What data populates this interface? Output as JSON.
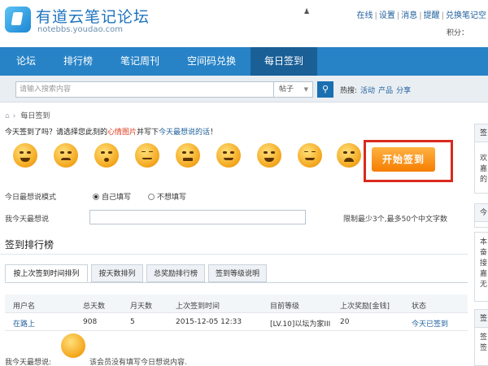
{
  "header": {
    "site_title": "有道云笔记论坛",
    "site_subtitle": "notebbs.youdao.com",
    "top_links": [
      "在线",
      "设置",
      "消息",
      "提醒",
      "兑换笔记空"
    ],
    "points_label": "积分：",
    "brand_color": "#2783c6"
  },
  "nav": {
    "items": [
      "论坛",
      "排行榜",
      "笔记周刊",
      "空间码兑换",
      "每日签到"
    ],
    "active": "每日签到"
  },
  "search": {
    "placeholder": "请输入搜索内容",
    "scope": "帖子",
    "hot_label": "热搜:",
    "hot_links": [
      "活动",
      "产品",
      "分享"
    ]
  },
  "breadcrumb": {
    "current": "每日签到"
  },
  "checkin": {
    "prompt_prefix": "今天签到了吗？请选择您此刻的",
    "prompt_mood": "心情图片",
    "prompt_mid": "并写下",
    "prompt_words": "今天最想说的话",
    "prompt_suffix": "！",
    "sign_button": "开始签到",
    "mode_label": "今日最想说模式",
    "mode_options": [
      "自己填写",
      "不想填写"
    ],
    "mode_selected": "自己填写",
    "say_label": "我今天最想说",
    "say_value": "",
    "limit_text": "限制最少3个,最多50个中文字数",
    "moods": [
      "grin",
      "sad",
      "dizzy",
      "sleepy",
      "angry",
      "sweat",
      "happy",
      "shy",
      "cry"
    ]
  },
  "ranking": {
    "title": "签到排行榜",
    "tabs": [
      "按上次签到时间排列",
      "按天数排列",
      "总奖励排行榜",
      "签到等级说明"
    ],
    "active_tab": "按上次签到时间排列",
    "columns": [
      "用户名",
      "总天数",
      "月天数",
      "上次签到时间",
      "目前等级",
      "上次奖励[金钱]",
      "状态"
    ],
    "rows": [
      [
        "在路上",
        "908",
        "5",
        "2015-12-05 12:33",
        "[LV.10]以坛为家III",
        "20",
        "今天已签到"
      ]
    ],
    "footer_label": "我今天最想说:",
    "footer_text": "该会员没有填写今日想说内容."
  },
  "sidebar": {
    "boxes": [
      {
        "head": "签",
        "lines": [
          "欢",
          "嘉",
          "的"
        ]
      },
      {
        "head": "今",
        "lines": []
      },
      {
        "head": "",
        "lines": [
          "本",
          "奋",
          "接",
          "嘉",
          "无"
        ]
      },
      {
        "head": "签",
        "lines": [
          "签",
          "签"
        ]
      }
    ]
  }
}
